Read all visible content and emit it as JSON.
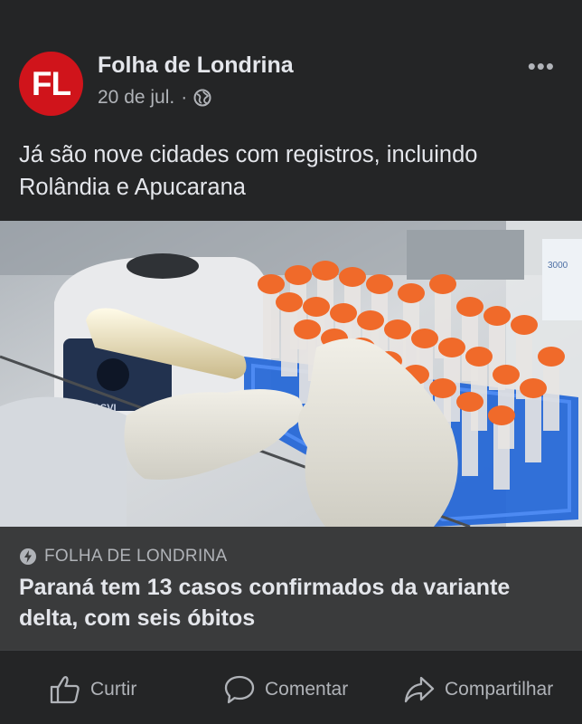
{
  "post": {
    "page_name": "Folha de Londrina",
    "avatar_text": "FL",
    "date": "20 de jul.",
    "separator": "·",
    "more_label": "•••",
    "text": "Já são nove cidades com registros, incluindo Rolândia e Apucarana"
  },
  "link": {
    "source": "FOLHA DE LONDRINA",
    "title": "Paraná tem 13 casos confirmados da variante delta, com seis óbitos",
    "image_texts": {
      "machine_label": "KASVI",
      "tube_label": "3000"
    }
  },
  "actions": {
    "like": "Curtir",
    "comment": "Comentar",
    "share": "Compartilhar"
  },
  "colors": {
    "background": "#242526",
    "link_box": "#3a3b3c",
    "avatar_red": "#d0141b",
    "text_primary": "#e4e6eb",
    "text_secondary": "#b0b3b8",
    "tube_cap_orange": "#f06a2a",
    "rack_blue": "#1e63d6"
  },
  "icons": [
    "globe-icon",
    "more-icon",
    "bolt-icon",
    "like-icon",
    "comment-icon",
    "share-icon"
  ]
}
